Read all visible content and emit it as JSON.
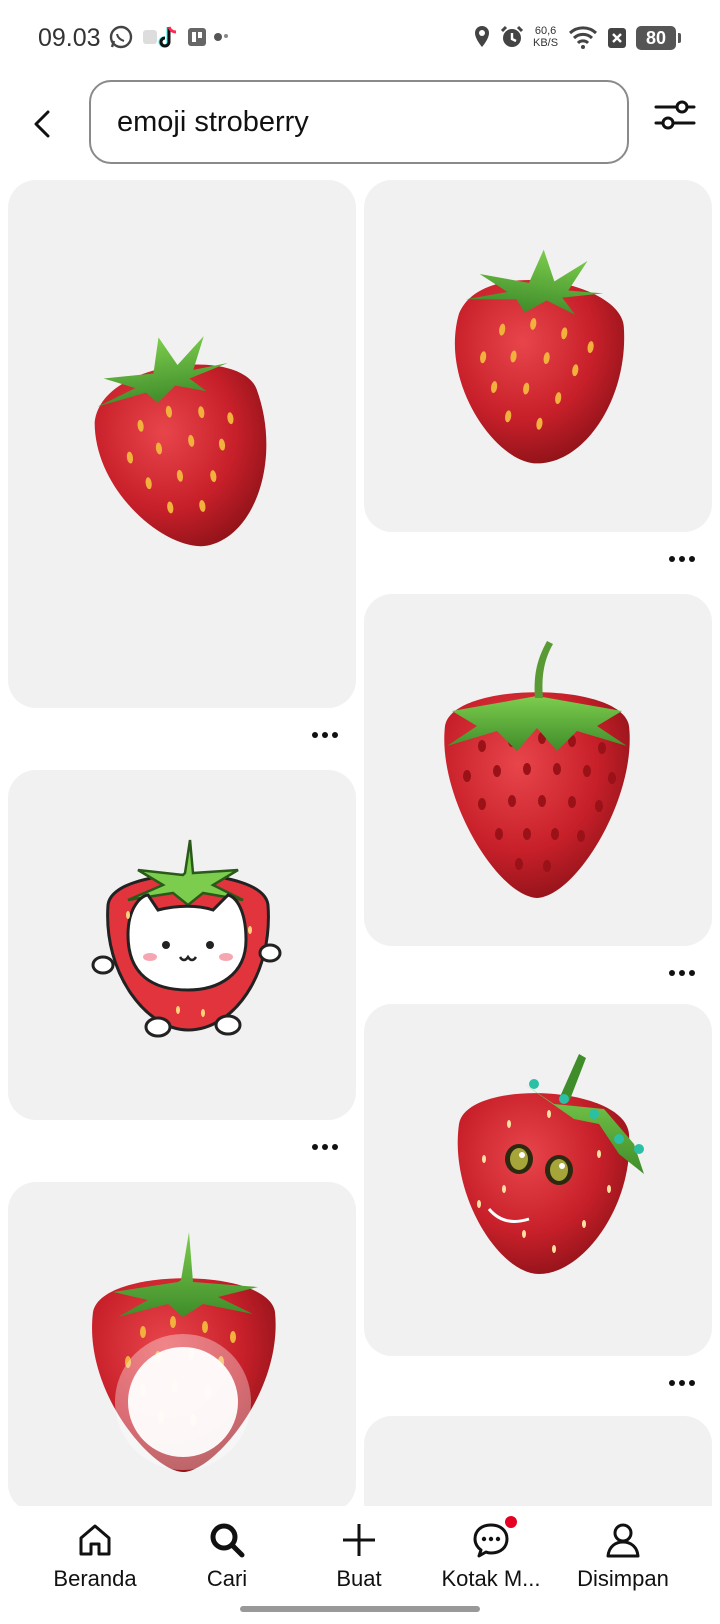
{
  "status_bar": {
    "time": "09.03",
    "network_speed_value": "60,6",
    "network_speed_unit": "KB/S",
    "battery": "80"
  },
  "search": {
    "value": "emoji stroberry"
  },
  "icons": {
    "back": "chevron-left-icon",
    "filter": "sliders-icon"
  },
  "pins": [
    {
      "description": "strawberry emoji",
      "style": "glossy"
    },
    {
      "description": "strawberry emoji",
      "style": "glossy"
    },
    {
      "description": "strawberry emoji",
      "style": "apple"
    },
    {
      "description": "strawberry cat sticker",
      "style": "cute"
    },
    {
      "description": "strawberry with face",
      "style": "face"
    },
    {
      "description": "strawberry with blurred center",
      "style": "glossy"
    }
  ],
  "nav": {
    "home": "Beranda",
    "search": "Cari",
    "create": "Buat",
    "inbox": "Kotak M...",
    "saved": "Disimpan"
  },
  "colors": {
    "accent": "#e60023",
    "card_bg": "#f1f1f1",
    "strawberry": "#c8202a",
    "leaf": "#5cab3a"
  }
}
